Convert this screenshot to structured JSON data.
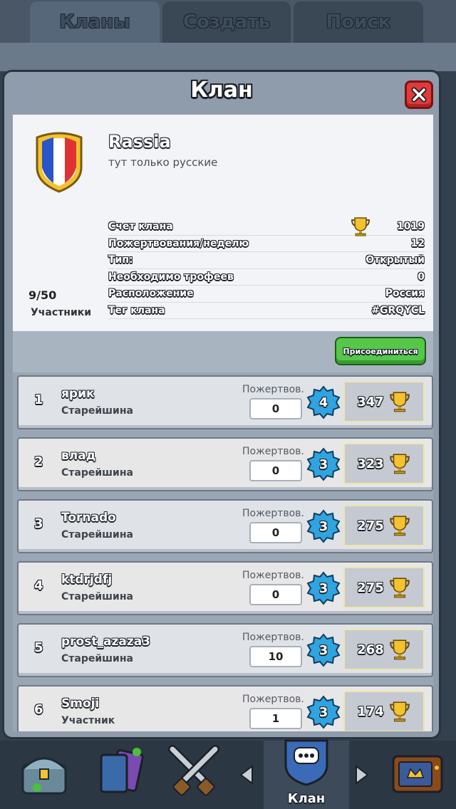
{
  "tabs": [
    {
      "label": "Кланы",
      "active": true
    },
    {
      "label": "Создать",
      "active": false
    },
    {
      "label": "Поиск",
      "active": false
    }
  ],
  "dialog": {
    "title": "Клан",
    "clan": {
      "name": "Rassia",
      "description": "тут только русские",
      "members": "9/50",
      "members_label": "Участники"
    },
    "stats": [
      {
        "label": "Счет клана",
        "value": "1019",
        "icon": "trophy-icon"
      },
      {
        "label": "Пожертвования/неделю",
        "value": "12"
      },
      {
        "label": "Тип:",
        "value": "Открытый"
      },
      {
        "label": "Необходимо трофеев",
        "value": "0"
      },
      {
        "label": "Расположение",
        "value": "Россия"
      },
      {
        "label": "Тег клана",
        "value": "#GRQYCL"
      }
    ],
    "join_label": "Присоединиться",
    "members_list": [
      {
        "rank": "1",
        "name": "ярик",
        "role": "Старейшина",
        "donations_label": "Пожертвов.",
        "donations": "0",
        "level": "4",
        "trophies": "347"
      },
      {
        "rank": "2",
        "name": "влад",
        "role": "Старейшина",
        "donations_label": "Пожертвов.",
        "donations": "0",
        "level": "3",
        "trophies": "323"
      },
      {
        "rank": "3",
        "name": "Tornado",
        "role": "Старейшина",
        "donations_label": "Пожертвов.",
        "donations": "0",
        "level": "3",
        "trophies": "275"
      },
      {
        "rank": "4",
        "name": "ktdrjdfj",
        "role": "Старейшина",
        "donations_label": "Пожертвов.",
        "donations": "0",
        "level": "3",
        "trophies": "275"
      },
      {
        "rank": "5",
        "name": "prost_azaza3",
        "role": "Старейшина",
        "donations_label": "Пожертвов.",
        "donations": "10",
        "level": "3",
        "trophies": "268"
      },
      {
        "rank": "6",
        "name": "Smoji",
        "role": "Участник",
        "donations_label": "Пожертвов.",
        "donations": "1",
        "level": "3",
        "trophies": "174"
      }
    ]
  },
  "bottom_nav": {
    "items": [
      "chest-shop-icon",
      "cards-icon",
      "battle-swords-icon",
      "clan-chat-icon",
      "tv-royale-icon"
    ],
    "active_label": "Клан"
  },
  "colors": {
    "join_green": "#55c84a",
    "close_red": "#e23a3a",
    "level_blue": "#2fa4e0",
    "trophy_gold": "#f2c230"
  }
}
